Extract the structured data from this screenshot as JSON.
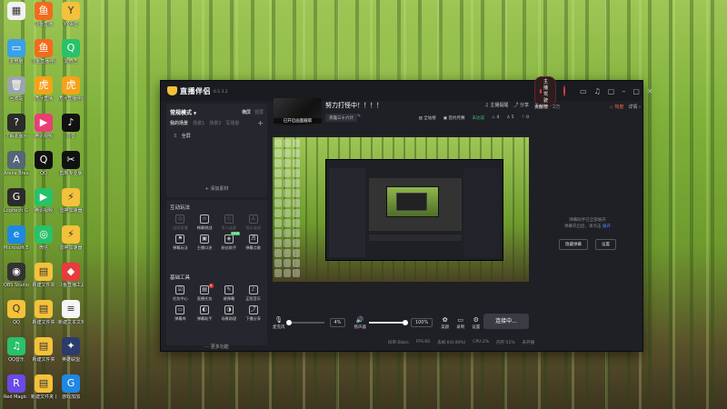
{
  "desktop": {
    "icons": [
      {
        "label": "",
        "color": "#f1f1f1",
        "glyph": "▦"
      },
      {
        "label": "斗鱼直播",
        "color": "#f26b1d",
        "glyph": "鱼"
      },
      {
        "label": "YY语音",
        "color": "#f4c13a",
        "glyph": "Y"
      },
      {
        "label": "此电脑",
        "color": "#3aa0e8",
        "glyph": "▭"
      },
      {
        "label": "斗鱼直播伴侣",
        "color": "#f26b1d",
        "glyph": "鱼"
      },
      {
        "label": "爱奇艺",
        "color": "#29c16a",
        "glyph": "Q"
      },
      {
        "label": "回收站",
        "color": "#9aa4ad",
        "glyph": "🗑"
      },
      {
        "label": "虎牙直播",
        "color": "#f4a21a",
        "glyph": "虎"
      },
      {
        "label": "虎牙直播伴侣",
        "color": "#f4a21a",
        "glyph": "虎"
      },
      {
        "label": "了解此图片",
        "color": "#2b2b2b",
        "glyph": "?"
      },
      {
        "label": "腾讯视频",
        "color": "#e83f76",
        "glyph": "▶"
      },
      {
        "label": "抖音",
        "color": "#111111",
        "glyph": "♪"
      },
      {
        "label": "Arena Breakout",
        "color": "#556677",
        "glyph": "A"
      },
      {
        "label": "QQ",
        "color": "#111111",
        "glyph": "Q"
      },
      {
        "label": "剪映专业版",
        "color": "#111111",
        "glyph": "✂"
      },
      {
        "label": "Logitech G HUB",
        "color": "#2b2b2b",
        "glyph": "G"
      },
      {
        "label": "腾讯视频",
        "color": "#29c16a",
        "glyph": "▶"
      },
      {
        "label": "雷神加速器",
        "color": "#f4c13a",
        "glyph": "⚡"
      },
      {
        "label": "Microsoft Edge",
        "color": "#1e88e5",
        "glyph": "e"
      },
      {
        "label": "微信",
        "color": "#29c16a",
        "glyph": "◎"
      },
      {
        "label": "雷神加速器",
        "color": "#f4c13a",
        "glyph": "⚡"
      },
      {
        "label": "OBS Studio",
        "color": "#333333",
        "glyph": "◉"
      },
      {
        "label": "新建文件夹",
        "color": "#f4c13a",
        "glyph": "▤"
      },
      {
        "label": "斗鱼直播工具",
        "color": "#e83b3b",
        "glyph": "◆"
      },
      {
        "label": "QQ",
        "color": "#f4c13a",
        "glyph": "Q"
      },
      {
        "label": "新建文件夹",
        "color": "#f4c13a",
        "glyph": "▤"
      },
      {
        "label": "新建文本文档",
        "color": "#f5f5f5",
        "glyph": "≡"
      },
      {
        "label": "QQ音乐",
        "color": "#29c16a",
        "glyph": "♫"
      },
      {
        "label": "新建文件夹",
        "color": "#f4c13a",
        "glyph": "▤"
      },
      {
        "label": "英雄联盟",
        "color": "#2b3b6b",
        "glyph": "✦"
      },
      {
        "label": "Red Magic Studio",
        "color": "#6a4ae8",
        "glyph": "R"
      },
      {
        "label": "新建文件夹 (4)",
        "color": "#f4c13a",
        "glyph": "▤"
      },
      {
        "label": "游戏加加",
        "color": "#1e88e5",
        "glyph": "G"
      }
    ]
  },
  "window": {
    "app_name": "直播伴侣",
    "version": "6.5.3.2",
    "live_badge": "主播驾驶",
    "title_icons": [
      "message-icon",
      "headset-icon",
      "chat-icon",
      "minimize-icon",
      "maximize-icon",
      "close-icon"
    ]
  },
  "left": {
    "mode_title": "常规模式",
    "mode_opts": [
      "横屏",
      "竖屏"
    ],
    "scene_tabs": [
      "我的场景",
      "场景1",
      "场景2",
      "写场景"
    ],
    "source_item": "全屏",
    "add_material": "添加素材",
    "interactive_title": "互动玩法",
    "interactive_tools": [
      {
        "label": "连线直播",
        "dim": true,
        "glyph": "◎"
      },
      {
        "label": "畅聊挑战",
        "dim": false,
        "glyph": "☆"
      },
      {
        "label": "多人连麦",
        "dim": true,
        "glyph": "◇"
      },
      {
        "label": "观众连线",
        "dim": true,
        "glyph": "♙"
      },
      {
        "label": "弹幕玩法",
        "dim": false,
        "glyph": "⚑"
      },
      {
        "label": "主播口述",
        "dim": false,
        "glyph": "▣"
      },
      {
        "label": "粉丝助手",
        "dim": false,
        "glyph": "◈",
        "badge": "NEW"
      },
      {
        "label": "弹幕点歌",
        "dim": false,
        "glyph": "♬"
      }
    ],
    "basic_title": "基础工具",
    "basic_tools": [
      {
        "label": "任务中心",
        "glyph": "☑"
      },
      {
        "label": "直播任务",
        "glyph": "▤",
        "count": "1"
      },
      {
        "label": "做弹幕",
        "glyph": "✎"
      },
      {
        "label": "正版音乐",
        "glyph": "♪"
      },
      {
        "label": "弹幕库",
        "glyph": "▭"
      },
      {
        "label": "弹幕助手",
        "glyph": "◐"
      },
      {
        "label": "场景助理",
        "glyph": "◑"
      },
      {
        "label": "下播分享",
        "glyph": "⤴"
      }
    ],
    "more_funcs": "更多功能"
  },
  "center": {
    "thumb_label": "已开启画面截取",
    "room_title": "努力打怪中！！！！",
    "room_category": "英雄三十六计",
    "room_edit": "✎",
    "metrics": [
      "全站榜",
      "签约月赛",
      "未达成"
    ],
    "stats": [
      "主播提醒",
      "分享"
    ],
    "counters": [
      "4",
      "5",
      "0"
    ],
    "mic_label": "麦克风",
    "mic_pct": "4%",
    "mic_level": 0.04,
    "speaker_label": "扬声器",
    "speaker_pct": "100%",
    "speaker_level": 1.0,
    "beauty_label": "美颜",
    "record_label": "录制",
    "settings_label": "设置",
    "connect_label": "连接中..."
  },
  "right": {
    "tabs": [
      "贡献榜",
      "2万",
      "详情"
    ],
    "hot_label": "热度",
    "message": "弹幕助手已全部展开",
    "message2": "弹幕开启后，请点击 ",
    "message_link": "展开",
    "btn_hide": "隐藏弹幕",
    "btn_settings": "设置"
  },
  "statusbar": [
    "码率:0kb/s",
    "FPS:60",
    "丢帧:0(0.00%)",
    "CPU:2%",
    "内存:51%",
    "未开播"
  ]
}
